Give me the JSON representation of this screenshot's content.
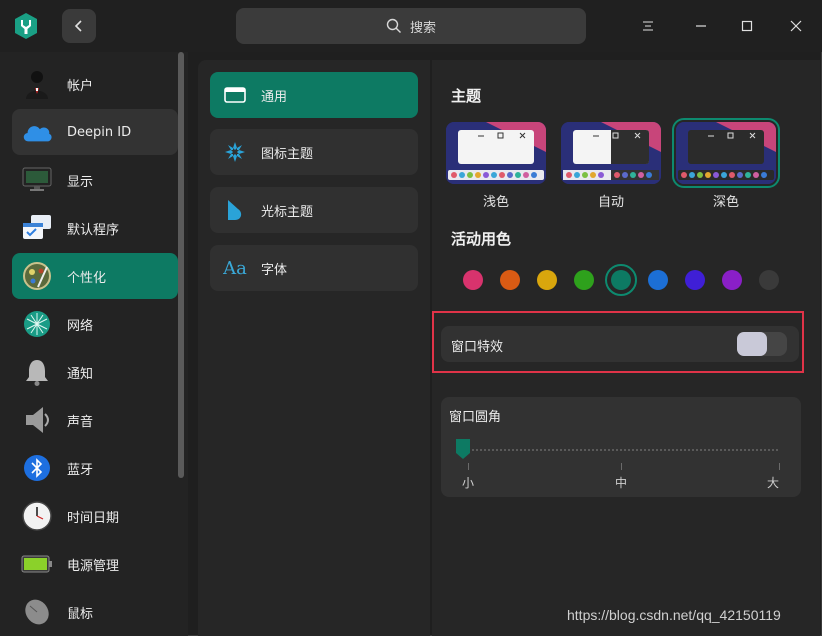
{
  "titlebar": {
    "search_placeholder": "搜索",
    "icons": [
      "app-icon",
      "back-icon",
      "search-icon",
      "menu-icon",
      "minimize-icon",
      "maximize-icon",
      "close-icon"
    ]
  },
  "sidebar": {
    "items": [
      {
        "label": "帐户",
        "icon": "account-icon"
      },
      {
        "label": "Deepin ID",
        "icon": "cloud-icon"
      },
      {
        "label": "显示",
        "icon": "display-icon"
      },
      {
        "label": "默认程序",
        "icon": "default-apps-icon"
      },
      {
        "label": "个性化",
        "icon": "personalization-icon",
        "active": true
      },
      {
        "label": "网络",
        "icon": "network-icon"
      },
      {
        "label": "通知",
        "icon": "bell-icon"
      },
      {
        "label": "声音",
        "icon": "speaker-icon"
      },
      {
        "label": "蓝牙",
        "icon": "bluetooth-icon"
      },
      {
        "label": "时间日期",
        "icon": "clock-icon"
      },
      {
        "label": "电源管理",
        "icon": "battery-icon"
      },
      {
        "label": "鼠标",
        "icon": "mouse-icon"
      }
    ]
  },
  "subnav": {
    "items": [
      {
        "label": "通用",
        "icon": "window-icon",
        "active": true
      },
      {
        "label": "图标主题",
        "icon": "icon-theme-icon"
      },
      {
        "label": "光标主题",
        "icon": "cursor-icon"
      },
      {
        "label": "字体",
        "icon": "font-icon"
      }
    ]
  },
  "content": {
    "theme_heading": "主题",
    "themes": [
      {
        "label": "浅色"
      },
      {
        "label": "自动"
      },
      {
        "label": "深色",
        "selected": true
      }
    ],
    "accent_heading": "活动用色",
    "accent_colors": [
      "#d8336d",
      "#d95b14",
      "#d9a60d",
      "#2ea11c",
      "#0d7a63",
      "#1c6fd6",
      "#3f1fd6",
      "#8a1fc7",
      "#3a3a3a"
    ],
    "selected_accent": "#0d7a63",
    "window_effects_label": "窗口特效",
    "window_effects_enabled": false,
    "corner_heading": "窗口圆角",
    "corner_scale": [
      "小",
      "中",
      "大"
    ],
    "corner_value": "小"
  },
  "watermark": "https://blog.csdn.net/qq_42150119"
}
